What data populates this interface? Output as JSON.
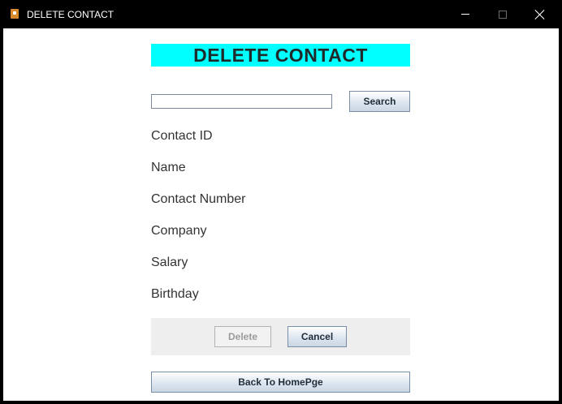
{
  "window": {
    "title": "DELETE CONTACT",
    "icon": "java-app-icon",
    "controls": [
      "minimize-icon",
      "maximize-icon",
      "close-icon"
    ]
  },
  "form": {
    "heading": "DELETE CONTACT",
    "heading_bg": "#00ffff",
    "search": {
      "value": "",
      "placeholder": "",
      "button_label": "Search"
    },
    "fields": {
      "contact_id": "Contact ID",
      "name": "Name",
      "contact_number": "Contact Number",
      "company": "Company",
      "salary": "Salary",
      "birthday": "Birthday"
    },
    "buttons": {
      "delete_label": "Delete",
      "delete_enabled": false,
      "cancel_label": "Cancel",
      "back_label": "Back To HomePge"
    }
  }
}
